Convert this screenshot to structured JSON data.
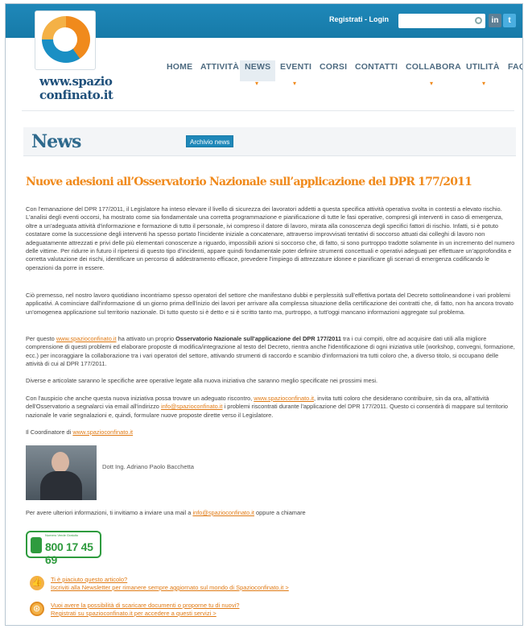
{
  "header": {
    "register_login": "Registrati - Login",
    "search_placeholder": "",
    "social": [
      "in",
      "t"
    ]
  },
  "logo": {
    "line1": "www.spazio",
    "line2": "confinato.it"
  },
  "nav": {
    "items": [
      "HOME",
      "ATTIVITÀ",
      "NEWS",
      "EVENTI",
      "CORSI",
      "CONTATTI",
      "COLLABORA",
      "UTILITÀ",
      "FAQ"
    ],
    "active": "NEWS"
  },
  "news": {
    "title": "News",
    "archive_button": "Archivio news"
  },
  "article": {
    "title": "Nuove adesioni all’Osservatorio Nazionale sull’applicazione del DPR 177/2011",
    "p1": "Con l'emanazione del DPR 177/2011, il Legislatore ha inteso elevare il livello di sicurezza dei lavoratori addetti a questa specifica attività operativa svolta in contesti a elevato rischio. L'analisi degli eventi occorsi, ha mostrato come sia fondamentale una corretta programmazione e pianificazione di tutte le fasi operative, compresi gli interventi in caso di emergenza, oltre a un'adeguata attività d'informazione e formazione di tutto il personale, ivi compreso il datore di lavoro, mirata alla conoscenza degli specifici fattori di rischio. Infatti, si è potuto costatare come la successione degli interventi ha spesso portato l'incidente iniziale a concatenare, attraverso improvvisati tentativi di soccorso attuati dai colleghi di lavoro non adeguatamente attrezzati e privi delle più elementari conoscenze a riguardo, impossibili azioni si soccorso che, di fatto, si sono purtroppo tradotte solamente in un incremento del numero delle vittime. Per ridurre in futuro il ripetersi di questo tipo d'incidenti, appare quindi fondamentale poter definire strumenti concettuali e operativi adeguati per effettuare un'approfondita e corretta valutazione dei rischi, identificare un percorso di addestramento efficace, prevedere l'impiego di attrezzature idonee e pianificare gli scenari di emergenza codificando le operazioni da porre in essere.",
    "p2": "Ciò premesso, nel nostro lavoro quotidiano incontriamo spesso operatori del settore che manifestano dubbi e perplessità sull'effettiva portata del Decreto sottolineandone i vari problemi applicativi. A cominciare dall'informazione di un giorno prima dell'inizio dei lavori per arrivare alla complessa situazione della certificazione dei contratti che, di fatto, non ha ancora trovato un'omogenea applicazione sul territorio nazionale. Di tutto questo si è detto e si è scritto tanto ma, purtroppo, a tutt'oggi mancano informazioni aggregate sul problema.",
    "p3_a": "Per questo ",
    "p3_link": "www.spazioconfinato.it",
    "p3_b": " ha attivato un proprio ",
    "p3_bold": "Osservatorio Nazionale sull'applicazione del DPR 177/2011",
    "p3_c": " tra i cui compiti, oltre ad acquisire dati utili alla migliore comprensione di questi problemi ed elaborare proposte di modifica/integrazione al testo del Decreto, rientra anche l'identificazione di ogni iniziativa utile (workshop, convegni, formazione, ecc.) per incoraggiare la collaborazione tra i vari operatori del settore, attivando strumenti di raccordo e scambio d'informazioni tra tutti coloro che, a diverso titolo, si occupano delle attività di cui al DPR 177/2011.",
    "p4": "Diverse e articolate saranno le specifiche aree operative legate alla nuova iniziativa che saranno meglio specificate nei prossimi mesi.",
    "p5_a": "Con l'auspicio che anche questa nuova iniziativa possa trovare un adeguato riscontro, ",
    "p5_link": "www.spazioconfinato.it",
    "p5_b": ", invita tutti coloro che desiderano contribuire, sin da ora, all'attività dell'Osservatorio a segnalarci via email all'indirizzo ",
    "p5_mail": "info@spazioconfinato.it",
    "p5_c": " i problemi riscontrati durante l'applicazione del DPR 177/2011. Questo ci consentirà di mappare sul territorio nazionale le varie segnalazioni e, quindi, formulare nuove proposte dirette verso il Legislatore.",
    "coordinator_prefix": "Il Coordinatore di ",
    "coordinator_link": "www.spazioconfinato.it",
    "author": "Dott Ing. Adriano Paolo Bacchetta",
    "contact_prefix": "Per avere ulteriori informazioni, ti invitiamo a inviare una mail a ",
    "contact_mail": "info@spazioconfinato.it",
    "contact_suffix": " oppure a chiamare"
  },
  "phone": {
    "label": "Numero Verde Gratuito",
    "number": "800 17 45 69"
  },
  "promo": {
    "like_line1": "Ti è piaciuto questo articolo?",
    "like_line2": "Iscriviti alla Newsletter per rimanere sempre aggiornato sul mondo di Spazioconfinato.it >",
    "docs_line1": "Vuoi avere la possibilità di scaricare documenti o proporne tu di nuovi?",
    "docs_line2": "Registrati su spazioconfinato.it per accedere a questi servizi >"
  }
}
